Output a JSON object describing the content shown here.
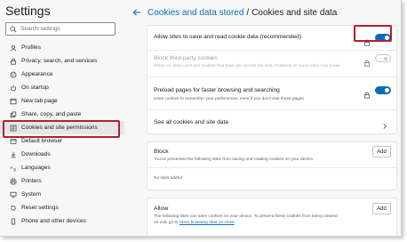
{
  "sidebar": {
    "title": "Settings",
    "search_placeholder": "Search settings",
    "items": [
      {
        "label": "Profiles",
        "icon": "profile-icon"
      },
      {
        "label": "Privacy, search, and services",
        "icon": "lock-icon"
      },
      {
        "label": "Appearance",
        "icon": "appearance-icon"
      },
      {
        "label": "On startup",
        "icon": "power-icon"
      },
      {
        "label": "New tab page",
        "icon": "newtab-icon"
      },
      {
        "label": "Share, copy, and paste",
        "icon": "share-icon"
      },
      {
        "label": "Cookies and site permissions",
        "icon": "site-permissions-icon",
        "selected": true
      },
      {
        "label": "Default browser",
        "icon": "browser-icon"
      },
      {
        "label": "Downloads",
        "icon": "download-icon"
      },
      {
        "label": "Languages",
        "icon": "languages-icon"
      },
      {
        "label": "Printers",
        "icon": "printer-icon"
      },
      {
        "label": "System",
        "icon": "system-icon"
      },
      {
        "label": "Reset settings",
        "icon": "reset-icon"
      },
      {
        "label": "Phone and other devices",
        "icon": "phone-icon"
      }
    ]
  },
  "header": {
    "breadcrumb": "Cookies and data stored",
    "separator": "/",
    "title": "Cookies and site data"
  },
  "settings": {
    "allow_sites": {
      "label": "Allow sites to save and read cookie data (recommended)",
      "state": "on"
    },
    "block_third_party": {
      "label": "Block third-party cookies",
      "description": "When on, sites can't use cookies that track you across the web. Features on some sites may break.",
      "state": "off (disabled)"
    },
    "preload": {
      "label": "Preload pages for faster browsing and searching",
      "description": "Uses cookies to remember your preferences, even if you don't visit those pages",
      "state": "on"
    },
    "see_all": {
      "label": "See all cookies and site data"
    }
  },
  "block": {
    "title": "Block",
    "description": "You've prevented the following sites from saving and reading cookies on your device.",
    "add_label": "Add",
    "empty_text": "No sites added"
  },
  "allow": {
    "title": "Allow",
    "description_line1": "The following sites can save cookies on your device. To prevent these cookies from being cleared",
    "description_line2_prefix": "on exit, go to",
    "description_link": "Clear browsing data on close",
    "description_suffix": ".",
    "add_label": "Add"
  },
  "colors": {
    "accent": "#0f6cbd",
    "highlight": "#b4202a"
  }
}
